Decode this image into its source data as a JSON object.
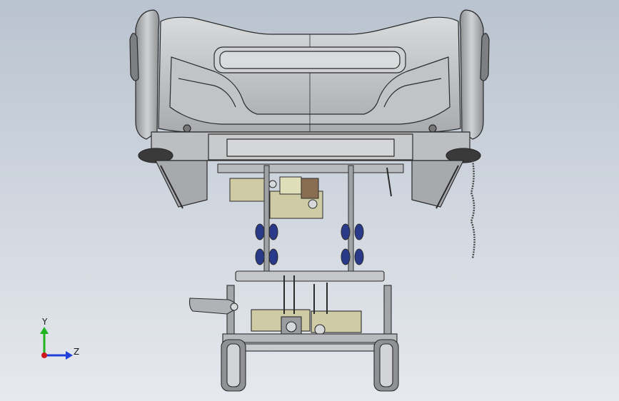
{
  "viewport": {
    "background_top": "#b9c3cf",
    "background_bottom": "#e6e9ee"
  },
  "triad": {
    "y_label": "Y",
    "z_label": "Z",
    "y_color": "#1fb31f",
    "z_color": "#1f3fd9",
    "x_color": "#d01818"
  },
  "colors": {
    "body_gray": "#b4b6b9",
    "body_light": "#d2d4d6",
    "edge": "#2b2b2b",
    "motor_khaki": "#cfcba4",
    "caster_blue": "#2a3a8a",
    "handle_blue": "#8896c4"
  }
}
